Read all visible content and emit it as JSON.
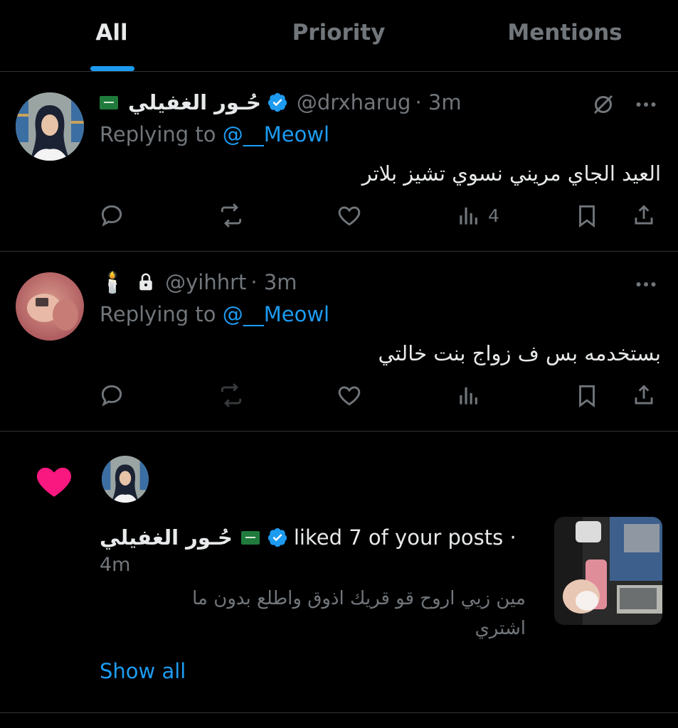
{
  "tabs": [
    {
      "label": "All",
      "active": true
    },
    {
      "label": "Priority",
      "active": false
    },
    {
      "label": "Mentions",
      "active": false
    }
  ],
  "posts": [
    {
      "display_name": "حُـور الغفيلي",
      "handle": "@drxharug",
      "time": "· 3m",
      "replying_prefix": "Replying to",
      "replying_to": "@__Meowl",
      "text": "العيد الجاي مريني نسوي تشيز بلاتر",
      "views": "4"
    },
    {
      "display_name": "🕯️",
      "handle": "@yihhrt",
      "time": "· 3m",
      "replying_prefix": "Replying to",
      "replying_to": "@__Meowl",
      "text": "بستخدمه بس ف زواج بنت خالتي",
      "views": ""
    }
  ],
  "like_notification": {
    "name": "حُـور الغفيلي",
    "action": "liked 7 of your posts ·",
    "time": "4m",
    "preview_line1": "مين زيي اروح قو قريك اذوق واطلع بدون ما",
    "preview_line2": "اشتري",
    "show_all": "Show all"
  },
  "colors": {
    "accent": "#1d9bf0",
    "like": "#f91880",
    "muted": "#71767b",
    "divider": "#2f3336"
  }
}
